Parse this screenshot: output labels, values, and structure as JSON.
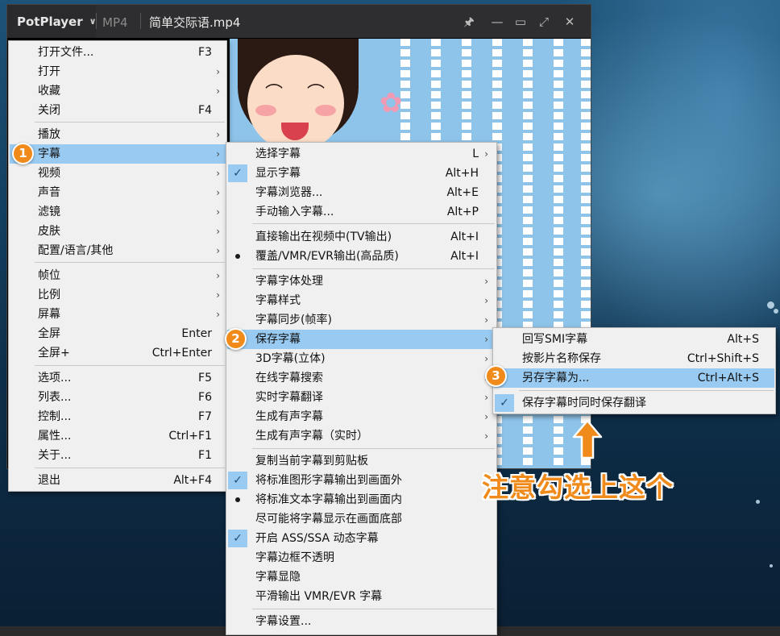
{
  "window": {
    "brand": "PotPlayer",
    "format": "MP4",
    "filename": "简单交际语.mp4",
    "controls": {
      "pin": "🖈",
      "minimize": "—",
      "maximize": "▭",
      "fullscreen": "⤢",
      "close": "✕"
    }
  },
  "menu_main": {
    "items": [
      {
        "label": "打开文件...",
        "shortcut": "F3"
      },
      {
        "label": "打开",
        "arrow": "›"
      },
      {
        "label": "收藏",
        "arrow": "›"
      },
      {
        "label": "关闭",
        "shortcut": "F4"
      },
      {
        "label": "播放",
        "arrow": "›"
      },
      {
        "label": "字幕",
        "arrow": "›"
      },
      {
        "label": "视频",
        "arrow": "›"
      },
      {
        "label": "声音",
        "arrow": "›"
      },
      {
        "label": "滤镜",
        "arrow": "›"
      },
      {
        "label": "皮肤",
        "arrow": "›"
      },
      {
        "label": "配置/语言/其他",
        "arrow": "›"
      },
      {
        "label": "帧位",
        "arrow": "›"
      },
      {
        "label": "比例",
        "arrow": "›"
      },
      {
        "label": "屏幕",
        "arrow": "›"
      },
      {
        "label": "全屏",
        "shortcut": "Enter"
      },
      {
        "label": "全屏+",
        "shortcut": "Ctrl+Enter"
      },
      {
        "label": "选项...",
        "shortcut": "F5"
      },
      {
        "label": "列表...",
        "shortcut": "F6"
      },
      {
        "label": "控制...",
        "shortcut": "F7"
      },
      {
        "label": "属性...",
        "shortcut": "Ctrl+F1"
      },
      {
        "label": "关于...",
        "shortcut": "F1"
      },
      {
        "label": "退出",
        "shortcut": "Alt+F4"
      }
    ]
  },
  "menu_subtitle": {
    "items": [
      {
        "label": "选择字幕",
        "shortcut": "L",
        "arrow": "›"
      },
      {
        "label": "显示字幕",
        "shortcut": "Alt+H",
        "checked": true
      },
      {
        "label": "字幕浏览器...",
        "shortcut": "Alt+E"
      },
      {
        "label": "手动输入字幕...",
        "shortcut": "Alt+P"
      },
      {
        "label": "直接输出在视频中(TV输出)",
        "shortcut": "Alt+I"
      },
      {
        "label": "覆盖/VMR/EVR输出(高品质)",
        "shortcut": "Alt+I",
        "radio": true
      },
      {
        "label": "字幕字体处理",
        "arrow": "›"
      },
      {
        "label": "字幕样式",
        "arrow": "›"
      },
      {
        "label": "字幕同步(帧率)",
        "arrow": "›"
      },
      {
        "label": "保存字幕",
        "arrow": "›"
      },
      {
        "label": "3D字幕(立体)",
        "arrow": "›"
      },
      {
        "label": "在线字幕搜索",
        "arrow": "›"
      },
      {
        "label": "实时字幕翻译",
        "arrow": "›"
      },
      {
        "label": "生成有声字幕",
        "arrow": "›"
      },
      {
        "label": "生成有声字幕（实时）",
        "arrow": "›"
      },
      {
        "label": "复制当前字幕到剪贴板"
      },
      {
        "label": "将标准图形字幕输出到画面外",
        "checked": true
      },
      {
        "label": "将标准文本字幕输出到画面内",
        "radio": true
      },
      {
        "label": "尽可能将字幕显示在画面底部"
      },
      {
        "label": "开启 ASS/SSA 动态字幕",
        "checked": true
      },
      {
        "label": "字幕边框不透明"
      },
      {
        "label": "字幕显隐"
      },
      {
        "label": "平滑输出 VMR/EVR 字幕"
      },
      {
        "label": "字幕设置..."
      }
    ]
  },
  "menu_save": {
    "items": [
      {
        "label": "回写SMI字幕",
        "shortcut": "Alt+S"
      },
      {
        "label": "按影片名称保存",
        "shortcut": "Ctrl+Shift+S"
      },
      {
        "label": "另存字幕为...",
        "shortcut": "Ctrl+Alt+S"
      },
      {
        "label": "保存字幕时同时保存翻译",
        "checked": true
      }
    ]
  },
  "badges": [
    "1",
    "2",
    "3"
  ],
  "annotation": "注意勾选上这个",
  "colors": {
    "accent": "#f08a1a",
    "highlight": "#99cbf2",
    "menu_bg": "#f0f0f0"
  },
  "icons": {
    "check": "✓",
    "flower": "✿"
  }
}
